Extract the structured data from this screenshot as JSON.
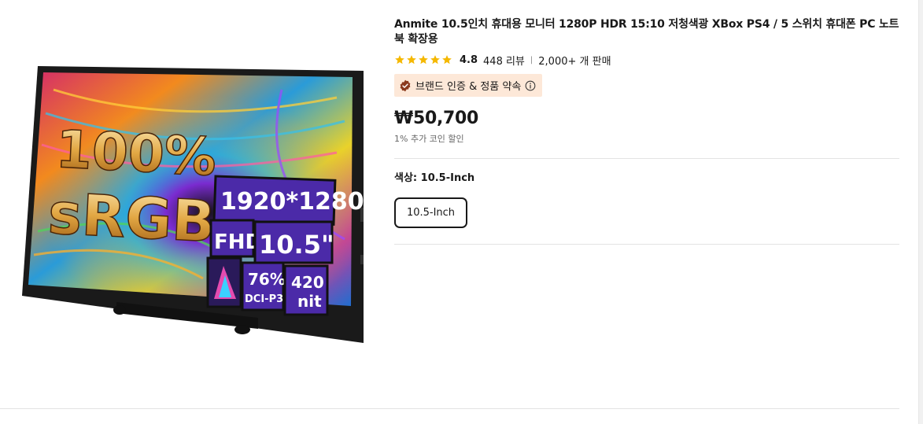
{
  "product": {
    "title": "Anmite 10.5인치 휴대용 모니터 1280P HDR 15:10 저청색광 XBox PS4 / 5 스위치 휴대폰 PC 노트북 확장용",
    "rating": "4.8",
    "reviews": "448 리뷰",
    "separator": "|",
    "sold": "2,000+ 개 판매",
    "badge": "브랜드 인증 & 정품 약속",
    "price": "₩50,700",
    "coin_discount": "1% 추가 코인 할인",
    "color_label": "색상: 10.5-Inch",
    "options": [
      "10.5-Inch"
    ]
  },
  "image_overlay": {
    "srgb_pct": "100%",
    "srgb": "sRGB",
    "resolution": "1920*1280",
    "fhd": "FHD",
    "size": "10.5\"",
    "dci": "76%",
    "dci_label": "DCI-P3",
    "nit": "420",
    "nit_label": "nit"
  },
  "colors": {
    "star": "#f5b800",
    "badge_bg": "#fde8d8",
    "badge_check": "#8b3a1e",
    "overlay_box": "#4b2aa8"
  }
}
